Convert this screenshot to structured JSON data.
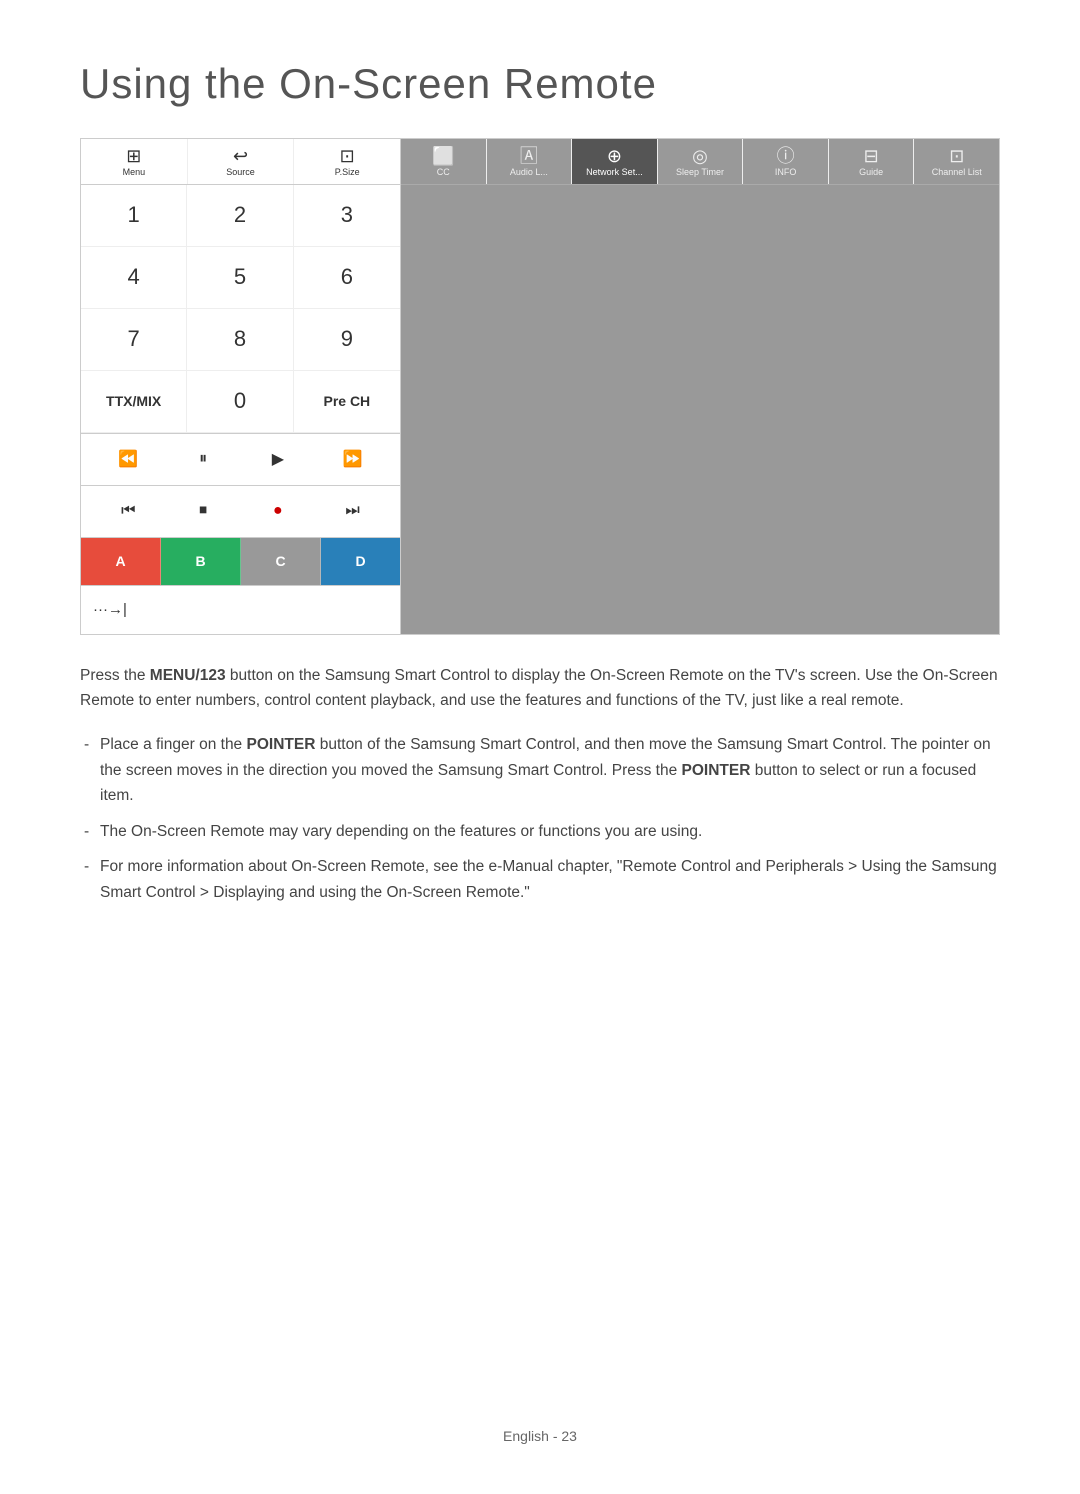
{
  "page": {
    "title": "Using the On-Screen Remote",
    "footer": "English - 23"
  },
  "remote": {
    "icon_buttons": [
      {
        "symbol": "⊞",
        "label": "Menu",
        "active": false
      },
      {
        "symbol": "⤶",
        "label": "Source",
        "active": false
      },
      {
        "symbol": "⊡",
        "label": "P.Size",
        "active": false
      },
      {
        "symbol": "⬜",
        "label": "CC",
        "active": false
      },
      {
        "symbol": "🄰",
        "label": "Audio L...",
        "active": false
      },
      {
        "symbol": "⊕",
        "label": "Network Set...",
        "active": true
      },
      {
        "symbol": "◎",
        "label": "Sleep Timer",
        "active": false
      },
      {
        "symbol": "ⓘ",
        "label": "INFO",
        "active": false
      },
      {
        "symbol": "⊟",
        "label": "Guide",
        "active": false
      },
      {
        "symbol": "⊡",
        "label": "Channel List",
        "active": false
      }
    ],
    "numpad": [
      "1",
      "2",
      "3",
      "4",
      "5",
      "6",
      "7",
      "8",
      "9",
      "TTX/MIX",
      "0",
      "Pre CH"
    ],
    "media_row1": [
      "⏪",
      "⏸",
      "▶",
      "⏩"
    ],
    "media_row2": [
      "⏮",
      "⏹",
      "●",
      "⏭"
    ],
    "color_buttons": [
      {
        "label": "A",
        "color": "red"
      },
      {
        "label": "B",
        "color": "green"
      },
      {
        "label": "C",
        "color": "grey"
      },
      {
        "label": "D",
        "color": "blue"
      }
    ],
    "extra_symbol": "···→|"
  },
  "content": {
    "main_para": "Press the MENU/123 button on the Samsung Smart Control to display the On-Screen Remote on the TV's screen. Use the On-Screen Remote to enter numbers, control content playback, and use the features and functions of the TV, just like a real remote.",
    "bullets": [
      "Place a finger on the POINTER button of the Samsung Smart Control, and then move the Samsung Smart Control. The pointer on the screen moves in the direction you moved the Samsung Smart Control. Press the POINTER button to select or run a focused item.",
      "The On-Screen Remote may vary depending on the features or functions you are using.",
      "For more information about On-Screen Remote, see the e-Manual chapter, \"Remote Control and Peripherals > Using the Samsung Smart Control > Displaying and using the On-Screen Remote.\""
    ],
    "bold_words_main": [
      "MENU/123"
    ],
    "bold_words_bullets": [
      "POINTER",
      "POINTER"
    ]
  }
}
